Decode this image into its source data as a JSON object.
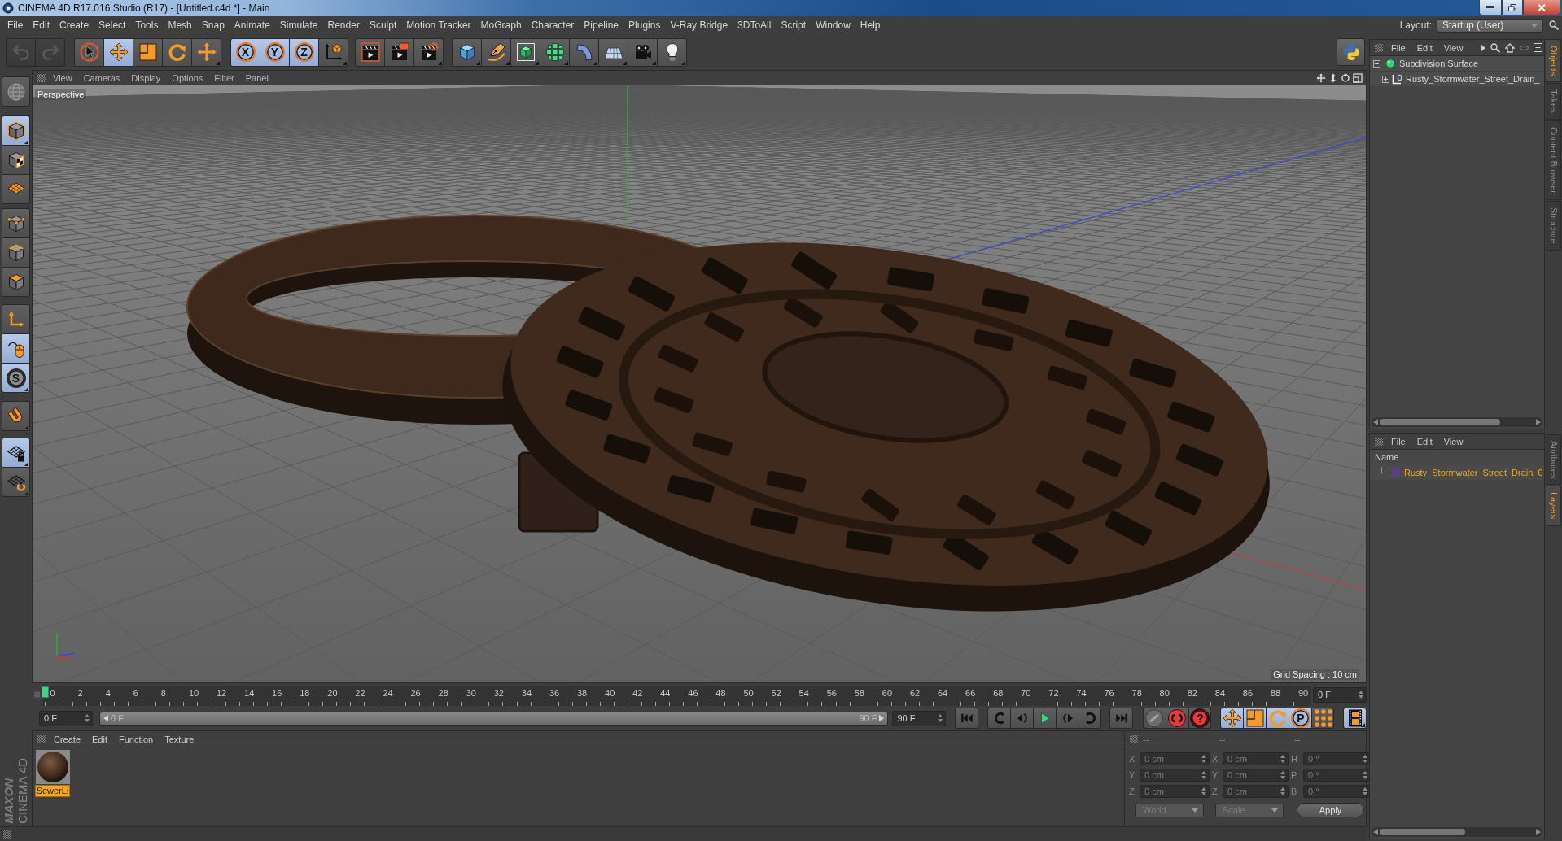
{
  "window": {
    "title": "CINEMA 4D R17.016 Studio (R17) - [Untitled.c4d *] - Main"
  },
  "menu_bar": {
    "items": [
      "File",
      "Edit",
      "Create",
      "Select",
      "Tools",
      "Mesh",
      "Snap",
      "Animate",
      "Simulate",
      "Render",
      "Sculpt",
      "Motion Tracker",
      "MoGraph",
      "Character",
      "Pipeline",
      "Plugins",
      "V-Ray Bridge",
      "3DToAll",
      "Script",
      "Window",
      "Help"
    ],
    "layout_label": "Layout:",
    "layout_value": "Startup (User)"
  },
  "main_toolbar": {
    "history": [
      {
        "kind": "undo",
        "disabled": true
      },
      {
        "kind": "redo",
        "disabled": true
      }
    ],
    "groups": [
      [
        {
          "kind": "select",
          "active": false
        },
        {
          "kind": "move",
          "active": true
        },
        {
          "kind": "scale",
          "active": false
        },
        {
          "kind": "rotate",
          "active": false
        },
        {
          "kind": "add",
          "active": false
        }
      ],
      [
        {
          "kind": "axis",
          "label": "X",
          "active": true
        },
        {
          "kind": "axis",
          "label": "Y",
          "active": true
        },
        {
          "kind": "axis",
          "label": "Z",
          "active": true
        },
        {
          "kind": "coords",
          "active": false
        }
      ],
      [
        {
          "kind": "render_view",
          "active": false
        },
        {
          "kind": "render_picture",
          "active": false
        },
        {
          "kind": "render_settings",
          "active": false
        }
      ],
      [
        {
          "kind": "cube",
          "active": false
        },
        {
          "kind": "pen",
          "active": false
        },
        {
          "kind": "subdivision",
          "active": false
        },
        {
          "kind": "cloner",
          "active": false
        },
        {
          "kind": "deformer",
          "active": false
        },
        {
          "kind": "floor",
          "active": false
        },
        {
          "kind": "camera",
          "active": false
        },
        {
          "kind": "light",
          "active": false
        }
      ]
    ]
  },
  "left_toolbar": {
    "groups": [
      [
        {
          "kind": "make_editable",
          "active": false
        }
      ],
      [
        {
          "kind": "model",
          "active": true
        },
        {
          "kind": "texture",
          "active": false
        },
        {
          "kind": "workplane",
          "active": false
        }
      ],
      [
        {
          "kind": "points",
          "active": false
        },
        {
          "kind": "edges",
          "active": false
        },
        {
          "kind": "polygons",
          "active": false
        }
      ],
      [
        {
          "kind": "axis_mode",
          "active": false
        },
        {
          "kind": "tweak",
          "active": true
        },
        {
          "kind": "snap",
          "label": "S",
          "active": true
        }
      ],
      [
        {
          "kind": "magnet",
          "active": false
        }
      ],
      [
        {
          "kind": "grid_lock",
          "active": true
        },
        {
          "kind": "grid_rotate",
          "active": false
        }
      ]
    ]
  },
  "viewport": {
    "menu": [
      "View",
      "Cameras",
      "Display",
      "Options",
      "Filter",
      "Panel"
    ],
    "camera_label": "Perspective",
    "grid_spacing": "Grid Spacing : 10 cm"
  },
  "timeline": {
    "labels": [
      "0",
      "2",
      "4",
      "6",
      "8",
      "10",
      "12",
      "14",
      "16",
      "18",
      "20",
      "22",
      "24",
      "26",
      "28",
      "30",
      "32",
      "34",
      "36",
      "38",
      "40",
      "42",
      "44",
      "46",
      "48",
      "50",
      "52",
      "54",
      "56",
      "58",
      "60",
      "62",
      "64",
      "66",
      "68",
      "70",
      "72",
      "74",
      "76",
      "78",
      "80",
      "82",
      "84",
      "86",
      "88",
      "90"
    ],
    "level": 0,
    "frame_field": "0 F"
  },
  "playback": {
    "start_field": "0 F",
    "range_start": "0 F",
    "range_end": "90 F",
    "end_field": "90 F",
    "key_groups": [
      [
        {
          "kind": "autokey",
          "active": false
        },
        {
          "kind": "record",
          "active": false
        },
        {
          "kind": "help",
          "label": "?",
          "active": false
        }
      ],
      [
        {
          "kind": "position",
          "active": true
        },
        {
          "kind": "size",
          "active": true
        },
        {
          "kind": "rotation",
          "active": true
        },
        {
          "kind": "parameter",
          "label": "P",
          "active": true
        },
        {
          "kind": "point_level",
          "active": false
        }
      ],
      [
        {
          "kind": "timeline",
          "active": true
        }
      ]
    ]
  },
  "materials": {
    "menu": [
      "Create",
      "Edit",
      "Function",
      "Texture"
    ],
    "items": [
      {
        "name": "SewerLi",
        "selected": true
      }
    ]
  },
  "coordinates": {
    "header": [
      "--",
      "--",
      "--"
    ],
    "rows": [
      [
        {
          "axis": "X",
          "value": "0 cm"
        },
        {
          "axis": "X",
          "value": "0 cm"
        },
        {
          "axis": "H",
          "value": "0 °"
        }
      ],
      [
        {
          "axis": "Y",
          "value": "0 cm"
        },
        {
          "axis": "Y",
          "value": "0 cm"
        },
        {
          "axis": "P",
          "value": "0 °"
        }
      ],
      [
        {
          "axis": "Z",
          "value": "0 cm"
        },
        {
          "axis": "Z",
          "value": "0 cm"
        },
        {
          "axis": "B",
          "value": "0 °"
        }
      ]
    ],
    "disabled": true,
    "mode": "World",
    "transform": "Scale",
    "apply": "Apply"
  },
  "logo": {
    "brand": "MAXON",
    "product": "CINEMA 4D"
  },
  "objects": {
    "menu": [
      "File",
      "Edit",
      "View"
    ],
    "tree": [
      {
        "name": "Subdivision Surface",
        "kind": "subdivision",
        "expanded": true,
        "children": [
          {
            "name": "Rusty_Stormwater_Street_Drain_",
            "kind": "null",
            "expanded": false
          }
        ]
      }
    ]
  },
  "layers": {
    "menu": [
      "File",
      "Edit",
      "View"
    ],
    "column": "Name",
    "rows": [
      {
        "name": "Rusty_Stormwater_Street_Drain_0",
        "color": "#5b3f86",
        "selected": true
      }
    ]
  },
  "side_tabs": {
    "top": [
      {
        "label": "Objects",
        "selected": true
      },
      {
        "label": "Takes",
        "selected": false
      },
      {
        "label": "Content Browser",
        "selected": false
      },
      {
        "label": "Structure",
        "selected": false
      }
    ],
    "bottom": [
      {
        "label": "Attributes",
        "selected": false
      },
      {
        "label": "Layers",
        "selected": true
      }
    ]
  }
}
